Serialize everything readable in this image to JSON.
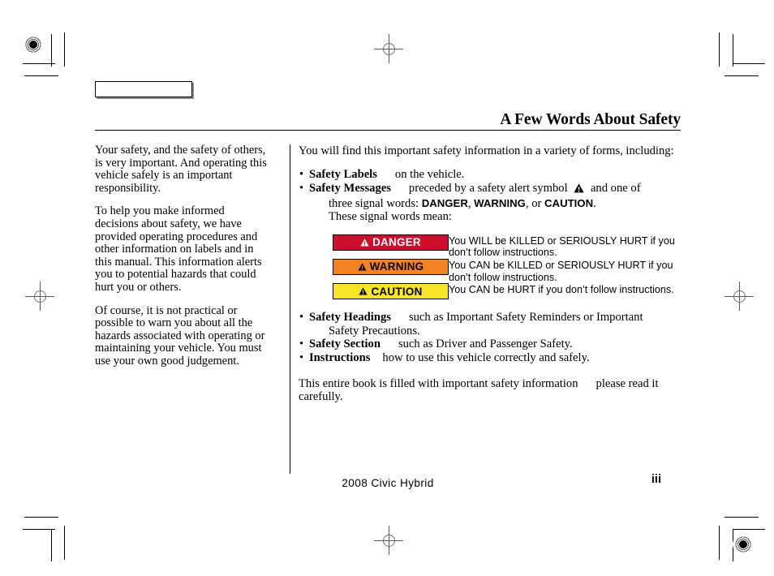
{
  "page": {
    "title": "A Few Words About Safety",
    "tab_box_label": "",
    "footer_text": "2008  Civic  Hybrid",
    "page_number": "iii"
  },
  "left_column": {
    "paragraphs": [
      "Your safety, and the safety of others, is very important. And operating this vehicle safely is an important responsibility.",
      "To help you make informed decisions about safety, we have provided operating procedures and other information on labels and in this manual. This information alerts you to potential hazards that could hurt you or others.",
      "Of course, it is not practical or possible to warn you about all the hazards associated with operating or maintaining your vehicle. You must use your own good judgement."
    ]
  },
  "right_column": {
    "intro": "You will find this important safety information in a variety of forms, including:",
    "bullets_upper": [
      {
        "term": "Safety Labels",
        "text": "on the vehicle."
      },
      {
        "term": "Safety Messages",
        "text_before_symbol": "preceded by a safety alert symbol",
        "symbol": "safety-alert-triangle",
        "text_after_symbol": "and one of",
        "continuation_prefix": "three signal words: ",
        "signal_word_1": "DANGER",
        "signal_sep_1": ", ",
        "signal_word_2": "WARNING",
        "signal_sep_2": ", or ",
        "signal_word_3": "CAUTION",
        "continuation_suffix": ".",
        "continuation_2": "These signal words mean:"
      }
    ],
    "signal_rows": [
      {
        "label": "DANGER",
        "bg_color": "#CE0E2D",
        "text_color": "#FFFFFF",
        "description": "You WILL be KILLED or SERIOUSLY HURT if you don’t follow instructions."
      },
      {
        "label": "WARNING",
        "bg_color": "#F58220",
        "text_color": "#000000",
        "description": "You CAN be KILLED or SERIOUSLY HURT if you don’t follow instructions."
      },
      {
        "label": "CAUTION",
        "bg_color": "#F7E628",
        "text_color": "#000000",
        "description": "You CAN be HURT if you don’t follow instructions."
      }
    ],
    "bullets_lower": [
      {
        "term": "Safety Headings",
        "text": "such as Important Safety Reminders or Important",
        "continuation": "Safety Precautions."
      },
      {
        "term": "Safety Section",
        "text": "such as Driver and Passenger Safety."
      },
      {
        "term": "Instructions",
        "text": "how to use this vehicle correctly and safely."
      }
    ],
    "closing": {
      "before_gap": "This entire book is filled with important safety information",
      "after_gap": "please read it carefully."
    }
  }
}
